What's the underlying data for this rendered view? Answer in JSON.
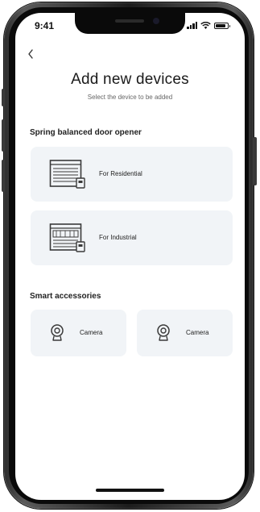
{
  "status_bar": {
    "time": "9:41"
  },
  "header": {
    "back_icon": "chevron-left-icon",
    "title": "Add new devices",
    "subtitle": "Select the device to be added"
  },
  "sections": [
    {
      "heading": "Spring balanced door opener",
      "items": [
        {
          "label": "For Residential",
          "icon": "garage-door-icon"
        },
        {
          "label": "For Industrial",
          "icon": "garage-door-icon"
        }
      ]
    },
    {
      "heading": "Smart accessories",
      "items": [
        {
          "label": "Camera",
          "icon": "camera-icon"
        },
        {
          "label": "Camera",
          "icon": "camera-icon"
        }
      ]
    }
  ],
  "colors": {
    "card_background": "#f1f4f7",
    "text": "#1a1a1a",
    "frame": "#1c1c1c"
  }
}
